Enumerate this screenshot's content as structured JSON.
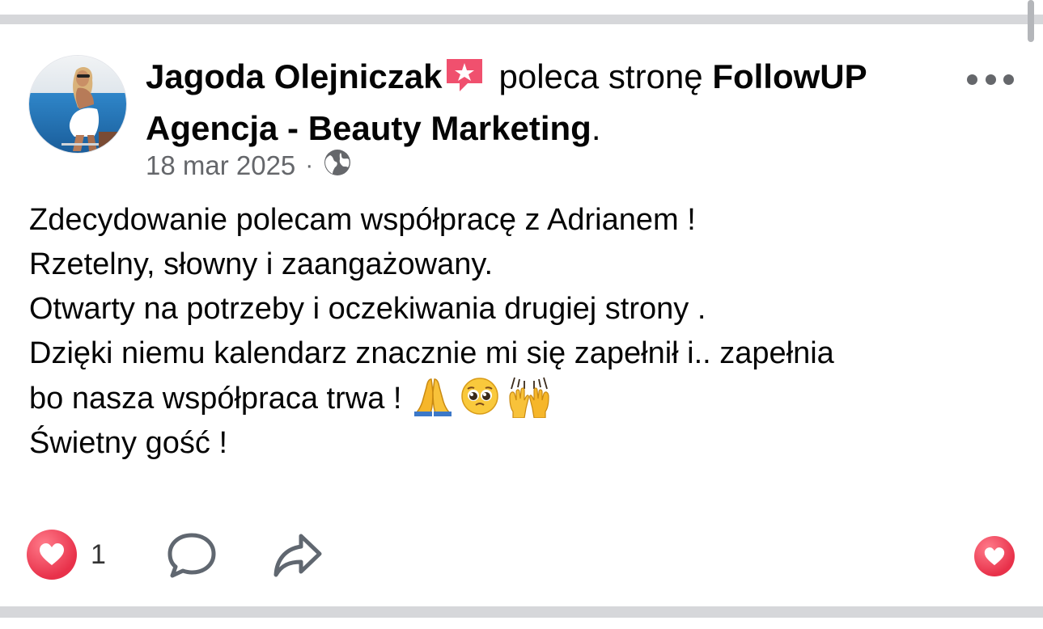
{
  "post": {
    "author": "Jagoda Olejniczak",
    "recommends_text": "poleca stronę",
    "page_name": "FollowUP Agencja - Beauty Marketing",
    "period": ".",
    "date": "18 mar 2025",
    "separator": "·",
    "audience_icon": "globe-icon",
    "body_lines": [
      "Zdecydowanie polecam współpracę z Adrianem !",
      "Rzetelny, słowny i zaangażowany.",
      "Otwarty na potrzeby i oczekiwania drugiej strony .",
      "Dzięki niemu kalendarz znacznie mi się zapełnił i.. zapełnia",
      "bo nasza współpraca trwa !",
      "",
      "Świetny gość !"
    ],
    "emojis": [
      "folded-hands-emoji",
      "pleading-face-emoji",
      "raising-hands-emoji"
    ]
  },
  "actions": {
    "like_count": "1",
    "icons": [
      "heart-icon",
      "comment-icon",
      "share-icon",
      "heart-react-icon"
    ]
  },
  "colors": {
    "reaction_red": "#e8314a",
    "secondary_text": "#65676b",
    "divider": "#d6d7da",
    "recommend_badge": "#f0506e"
  }
}
